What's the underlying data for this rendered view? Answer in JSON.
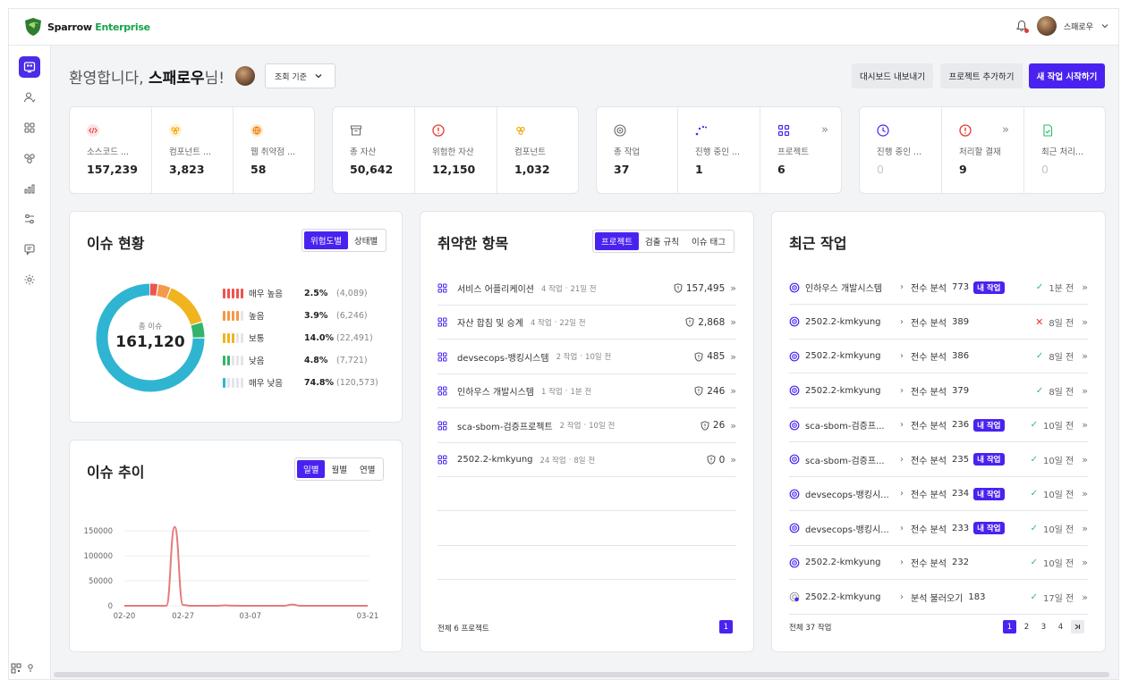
{
  "brand": {
    "name_part1": "Sparrow",
    "name_part2": "Enterprise"
  },
  "user": {
    "name": "스패로우"
  },
  "greeting": {
    "prefix": "환영합니다,",
    "name": "스패로우",
    "suffix": "님!"
  },
  "period_select": {
    "label": "조회 기준"
  },
  "header_buttons": {
    "export": "대시보드 내보내기",
    "add_project": "프로젝트 추가하기",
    "new_task": "새 작업 시작하기"
  },
  "stat_groups": [
    {
      "items": [
        {
          "label": "소스코드 ...",
          "value": "157,239",
          "icon": "code-icon"
        },
        {
          "label": "컴포넌트 ...",
          "value": "3,823",
          "icon": "component-icon"
        },
        {
          "label": "웹 취약점 ...",
          "value": "58",
          "icon": "globe-icon"
        }
      ]
    },
    {
      "items": [
        {
          "label": "총 자산",
          "value": "50,642",
          "icon": "archive-icon"
        },
        {
          "label": "위험한 자산",
          "value": "12,150",
          "icon": "alert-icon"
        },
        {
          "label": "컴포넌트",
          "value": "1,032",
          "icon": "component-icon"
        }
      ]
    },
    {
      "items": [
        {
          "label": "총 작업",
          "value": "37",
          "icon": "target-icon"
        },
        {
          "label": "진행 중인 ...",
          "value": "1",
          "icon": "spinner-icon"
        },
        {
          "label": "프로젝트",
          "value": "6",
          "icon": "grid-icon"
        }
      ]
    },
    {
      "items": [
        {
          "label": "진행 중인 ...",
          "value": "0",
          "icon": "clock-icon"
        },
        {
          "label": "처리할 결재",
          "value": "9",
          "icon": "alert-icon"
        },
        {
          "label": "최근 처리...",
          "value": "0",
          "icon": "doc-check-icon"
        }
      ]
    }
  ],
  "issue_status": {
    "title": "이슈 현황",
    "toggle": [
      "위험도별",
      "상태별"
    ],
    "center_label": "총 이슈",
    "total": "161,120",
    "levels": [
      {
        "name": "매우 높음",
        "pct": "2.5%",
        "count": "(4,089)",
        "color": "#ef5350",
        "share": 2.5
      },
      {
        "name": "높음",
        "pct": "3.9%",
        "count": "(6,246)",
        "color": "#f2994a",
        "share": 3.9
      },
      {
        "name": "보통",
        "pct": "14.0%",
        "count": "(22,491)",
        "color": "#f0b41f",
        "share": 14.0
      },
      {
        "name": "낮음",
        "pct": "4.8%",
        "count": "(7,721)",
        "color": "#34b36b",
        "share": 4.8
      },
      {
        "name": "매우 낮음",
        "pct": "74.8%",
        "count": "(120,573)",
        "color": "#2fb5d1",
        "share": 74.8
      }
    ]
  },
  "issue_trend": {
    "title": "이슈 추이",
    "toggle": [
      "일별",
      "월별",
      "연별"
    ],
    "chart_data": {
      "type": "line",
      "x": [
        "02-20",
        "02-21",
        "02-22",
        "02-23",
        "02-24",
        "02-25",
        "02-26",
        "02-27",
        "02-28",
        "03-01",
        "03-02",
        "03-03",
        "03-04",
        "03-05",
        "03-06",
        "03-07",
        "03-08",
        "03-09",
        "03-10",
        "03-11",
        "03-12",
        "03-13",
        "03-14",
        "03-15",
        "03-16",
        "03-17",
        "03-18",
        "03-19",
        "03-20",
        "03-21"
      ],
      "tick_labels": [
        "02-20",
        "02-27",
        "03-07",
        "03-21"
      ],
      "series": [
        {
          "values": [
            0,
            0,
            0,
            0,
            0,
            200,
            158000,
            1500,
            0,
            0,
            0,
            0,
            800,
            300,
            0,
            0,
            0,
            0,
            0,
            0,
            2500,
            0,
            0,
            0,
            0,
            0,
            0,
            0,
            0,
            0
          ],
          "color": "#e57b7b"
        }
      ],
      "y_ticks": [
        "150000",
        "100000",
        "50000",
        "0"
      ],
      "ylim": [
        0,
        170000
      ],
      "grid": true
    }
  },
  "vuln_items": {
    "title": "취약한 항목",
    "toggle": [
      "프로젝트",
      "검출 규칙",
      "이슈 태그"
    ],
    "rows": [
      {
        "name": "서비스 어플리케이션",
        "tasks": "4 작업",
        "time": "21일 전",
        "count": "157,495"
      },
      {
        "name": "자산 합침 및 승계",
        "tasks": "4 작업",
        "time": "22일 전",
        "count": "2,868"
      },
      {
        "name": "devsecops-뱅킹시스템",
        "tasks": "2 작업",
        "time": "10일 전",
        "count": "485"
      },
      {
        "name": "인하우스 개발시스템",
        "tasks": "1 작업",
        "time": "1분 전",
        "count": "246"
      },
      {
        "name": "sca-sbom-검증프로젝트",
        "tasks": "2 작업",
        "time": "10일 전",
        "count": "26"
      },
      {
        "name": "2502.2-kmkyung",
        "tasks": "24 작업",
        "time": "8일 전",
        "count": "0"
      }
    ],
    "footer": "전체 6 프로젝트",
    "pages": [
      "1"
    ]
  },
  "recent_work": {
    "title": "최근 작업",
    "rows": [
      {
        "project": "인하우스 개발시스템",
        "kind": "전수 분석",
        "num": "773",
        "badge": "내 작업",
        "status": "ok",
        "time": "1분 전",
        "icon": "target-icon"
      },
      {
        "project": "2502.2-kmkyung",
        "kind": "전수 분석",
        "num": "389",
        "badge": "",
        "status": "fail",
        "time": "8일 전",
        "icon": "target-icon"
      },
      {
        "project": "2502.2-kmkyung",
        "kind": "전수 분석",
        "num": "386",
        "badge": "",
        "status": "ok",
        "time": "8일 전",
        "icon": "target-icon"
      },
      {
        "project": "2502.2-kmkyung",
        "kind": "전수 분석",
        "num": "379",
        "badge": "",
        "status": "ok",
        "time": "8일 전",
        "icon": "target-icon"
      },
      {
        "project": "sca-sbom-검증프...",
        "kind": "전수 분석",
        "num": "236",
        "badge": "내 작업",
        "status": "ok",
        "time": "10일 전",
        "icon": "target-icon"
      },
      {
        "project": "sca-sbom-검증프...",
        "kind": "전수 분석",
        "num": "235",
        "badge": "내 작업",
        "status": "ok",
        "time": "10일 전",
        "icon": "target-icon"
      },
      {
        "project": "devsecops-뱅킹시...",
        "kind": "전수 분석",
        "num": "234",
        "badge": "내 작업",
        "status": "ok",
        "time": "10일 전",
        "icon": "target-icon"
      },
      {
        "project": "devsecops-뱅킹시...",
        "kind": "전수 분석",
        "num": "233",
        "badge": "내 작업",
        "status": "ok",
        "time": "10일 전",
        "icon": "target-icon"
      },
      {
        "project": "2502.2-kmkyung",
        "kind": "전수 분석",
        "num": "232",
        "badge": "",
        "status": "ok",
        "time": "10일 전",
        "icon": "target-icon"
      },
      {
        "project": "2502.2-kmkyung",
        "kind": "분석 불러오기",
        "num": "183",
        "badge": "",
        "status": "ok",
        "time": "17일 전",
        "icon": "import-icon"
      }
    ],
    "footer": "전체 37 작업",
    "pages": [
      "1",
      "2",
      "3",
      "4"
    ]
  },
  "colors": {
    "accent": "#4a22f0",
    "brand_green": "#18a34a"
  }
}
